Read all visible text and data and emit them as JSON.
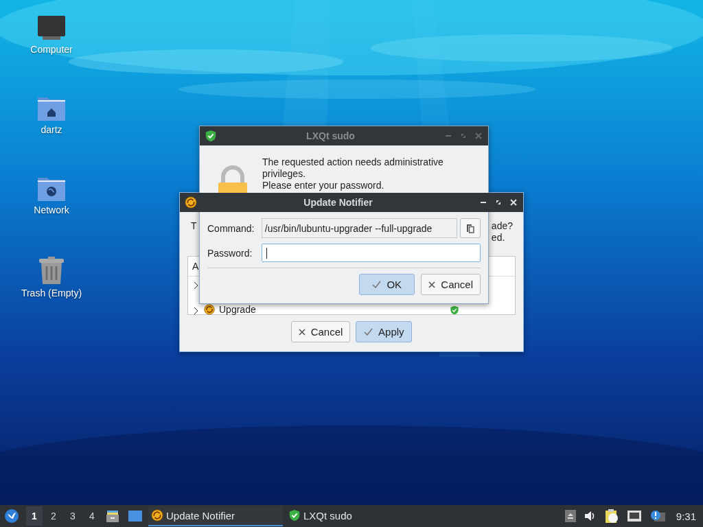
{
  "desktop": {
    "icons": [
      {
        "label": "Computer",
        "kind": "computer"
      },
      {
        "label": "dartz",
        "kind": "home"
      },
      {
        "label": "Network",
        "kind": "network"
      },
      {
        "label": "Trash (Empty)",
        "kind": "trash"
      }
    ]
  },
  "update_notifier": {
    "title": "Update Notifier",
    "active": true,
    "question_left": "T",
    "question_right": [
      "ade?",
      "ed."
    ],
    "table": {
      "column_1": "A",
      "rows": [
        {
          "expanded": false
        },
        {
          "name": "Upgrade",
          "expanded": false
        }
      ]
    },
    "buttons": [
      {
        "label": "Cancel",
        "kind": "cancel",
        "default": false
      },
      {
        "label": "Apply",
        "kind": "apply",
        "default": true
      }
    ]
  },
  "sudo": {
    "title": "LXQt sudo",
    "active": false,
    "message": "The requested action needs administrative privileges.",
    "prompt": "Please enter your password.",
    "command": {
      "label": "Command:",
      "value": "/usr/bin/lubuntu-upgrader --full-upgrade"
    },
    "password": {
      "label": "Password:",
      "focused": true
    },
    "buttons": [
      {
        "label": "OK",
        "kind": "ok",
        "default": true
      },
      {
        "label": "Cancel",
        "kind": "cancel",
        "default": false
      }
    ]
  },
  "taskbar": {
    "workspaces": [
      {
        "label": "1",
        "selected": true
      },
      {
        "label": "2",
        "selected": false
      },
      {
        "label": "3",
        "selected": false
      },
      {
        "label": "4",
        "selected": false
      }
    ],
    "tasks": [
      {
        "label": "Update Notifier",
        "kind": "updater",
        "selected": true
      },
      {
        "label": "LXQt sudo",
        "kind": "sudo",
        "selected": false
      }
    ],
    "clock": "9:31"
  }
}
